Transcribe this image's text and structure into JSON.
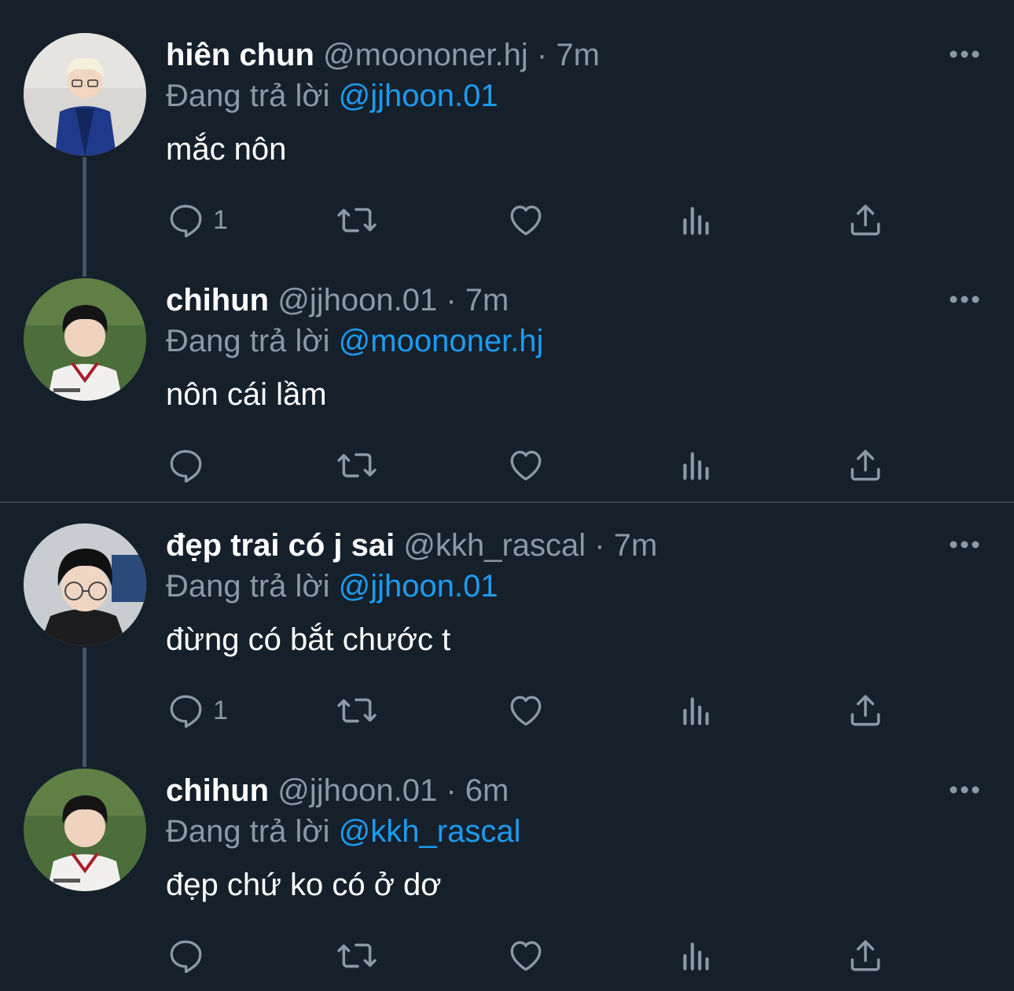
{
  "theme": {
    "background": "#15202b",
    "text_primary": "#ffffff",
    "text_secondary": "#8b98a5",
    "mention": "#1d9bf0",
    "divider": "#38444d"
  },
  "tweets": [
    {
      "name": "hiên chun",
      "handle": "@moononer.hj",
      "separator": "·",
      "time": "7m",
      "replying_label": "Đang trả lời",
      "replying_to": "@jjhoon.01",
      "text": "mắc nôn",
      "reply_count": "1",
      "icons": [
        "reply-icon",
        "retweet-icon",
        "like-icon",
        "views-icon",
        "share-icon"
      ]
    },
    {
      "name": "chihun",
      "handle": "@jjhoon.01",
      "separator": "·",
      "time": "7m",
      "replying_label": "Đang trả lời",
      "replying_to": "@moononer.hj",
      "text": "nôn cái lầm",
      "reply_count": ""
    },
    {
      "name": "đẹp trai có j sai",
      "handle": "@kkh_rascal",
      "separator": "·",
      "time": "7m",
      "replying_label": "Đang trả lời",
      "replying_to": "@jjhoon.01",
      "text": "đừng có bắt chước t",
      "reply_count": "1"
    },
    {
      "name": "chihun",
      "handle": "@jjhoon.01",
      "separator": "·",
      "time": "6m",
      "replying_label": "Đang trả lời",
      "replying_to": "@kkh_rascal",
      "text": "đẹp chứ ko có ở dơ",
      "reply_count": ""
    }
  ]
}
